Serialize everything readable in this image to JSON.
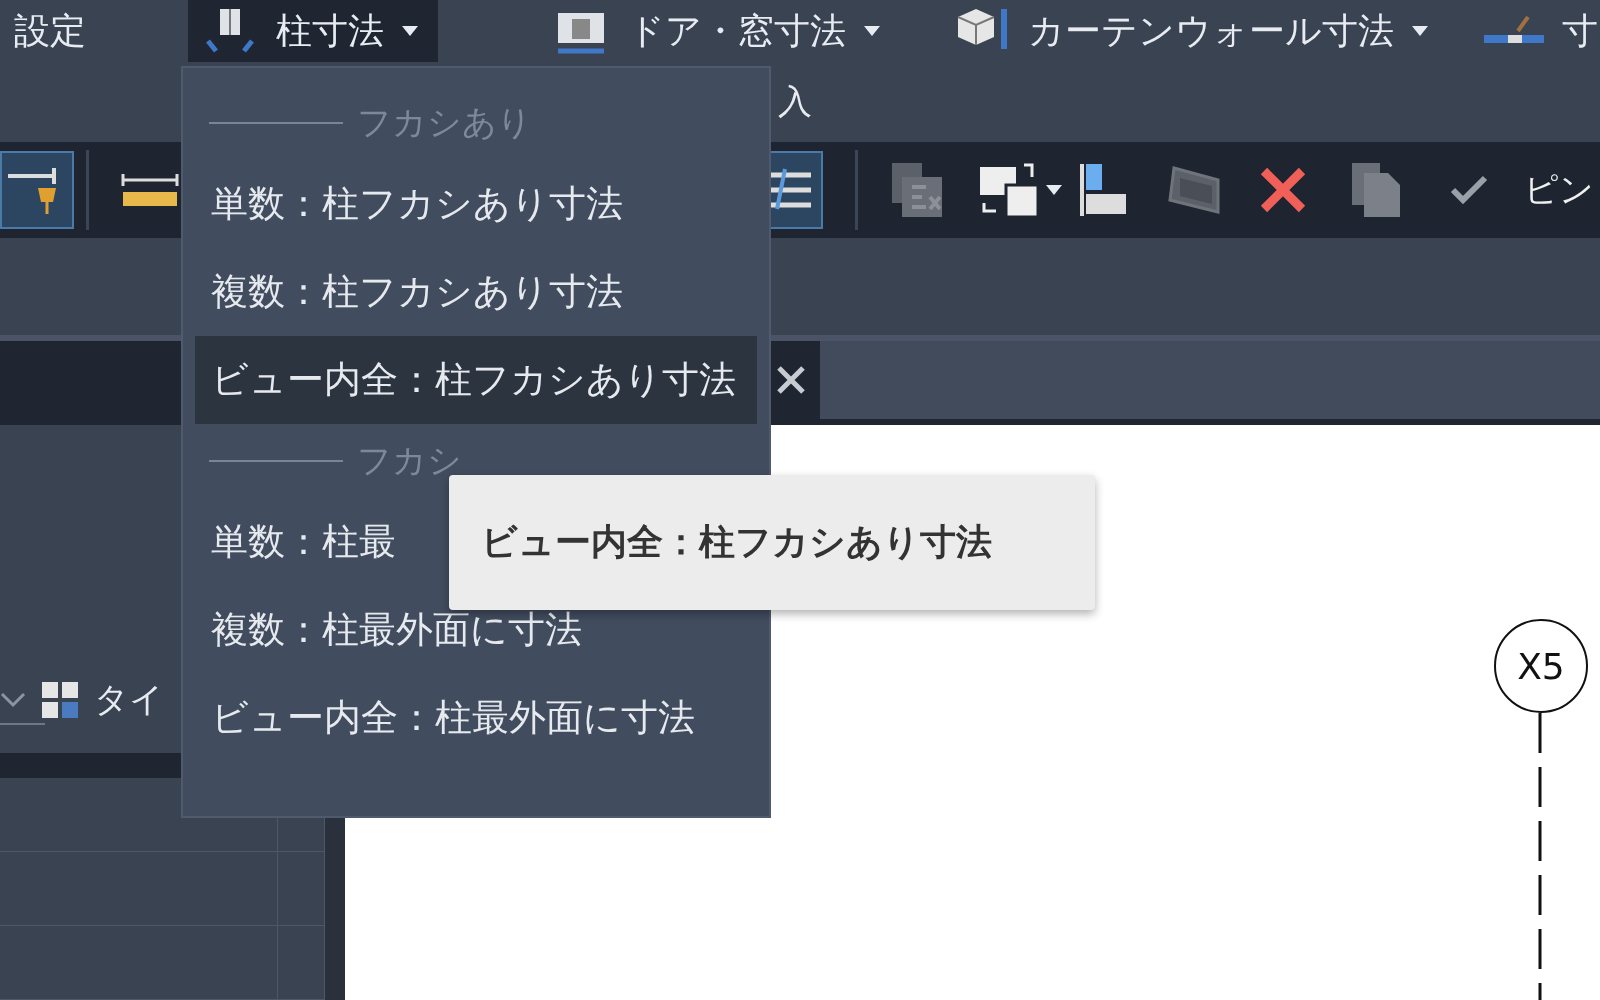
{
  "ribbon": {
    "buttons": [
      {
        "label": "設定",
        "kind": "plain",
        "open": false
      },
      {
        "label": "柱寸法",
        "kind": "dropdown",
        "open": true
      },
      {
        "label": "ドア・窓寸法",
        "kind": "dropdown",
        "open": false
      },
      {
        "label": "カーテンウォール寸法",
        "kind": "dropdown",
        "open": false
      },
      {
        "label": "寸",
        "kind": "iconed",
        "open": false
      }
    ],
    "row2_labels": [
      "入"
    ]
  },
  "toolbar": {
    "tools": [
      {
        "active": true
      },
      {
        "active": false
      },
      {
        "active": true
      },
      {
        "active": false
      },
      {
        "active": false
      },
      {
        "active": false
      },
      {
        "active": false
      },
      {
        "active": false
      },
      {
        "active": false
      },
      {
        "active": false
      }
    ],
    "pin_label": "ピン"
  },
  "menu": {
    "sections": [
      {
        "header": "フカシあり",
        "items": [
          {
            "label": "単数：柱フカシあり寸法",
            "selected": false
          },
          {
            "label": "複数：柱フカシあり寸法",
            "selected": false
          },
          {
            "label": "ビュー内全：柱フカシあり寸法",
            "selected": true
          }
        ]
      },
      {
        "header": "フカシ",
        "items": [
          {
            "label": "単数：柱最",
            "selected": false
          },
          {
            "label": "複数：柱最外面に寸法",
            "selected": false
          },
          {
            "label": "ビュー内全：柱最外面に寸法",
            "selected": false
          }
        ]
      }
    ]
  },
  "tooltip": {
    "text": "ビュー内全：柱フカシあり寸法"
  },
  "properties": {
    "type_label": "タイ"
  },
  "canvas": {
    "grid_bubble": "X5"
  }
}
